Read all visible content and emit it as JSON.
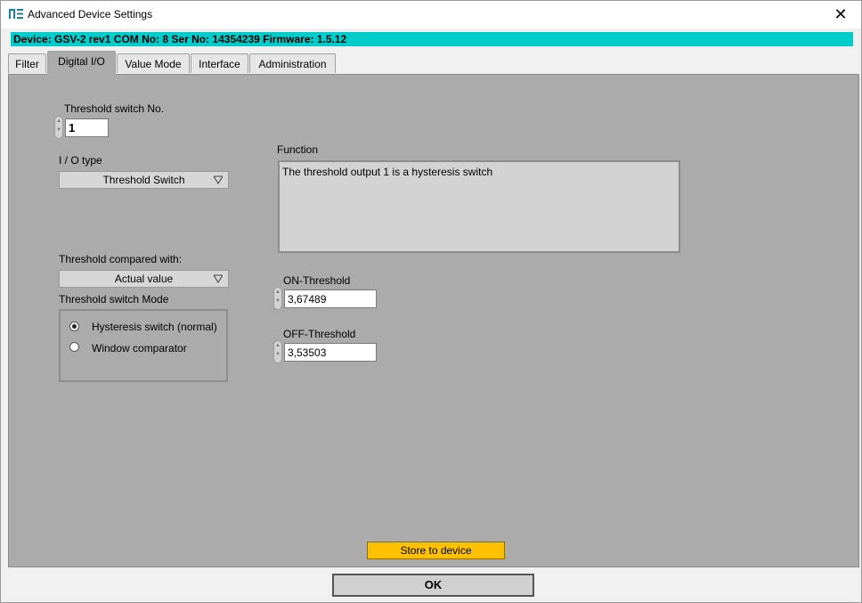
{
  "window": {
    "title": "Advanced Device Settings",
    "close_glyph": "✕"
  },
  "device_banner": "Device: GSV-2 rev1 COM No: 8 Ser No: 14354239 Firmware: 1.5.12",
  "tabs": [
    {
      "label": "Filter",
      "active": false
    },
    {
      "label": "Digital I/O",
      "active": true
    },
    {
      "label": "Value Mode",
      "active": false
    },
    {
      "label": "Interface",
      "active": false
    },
    {
      "label": "Administration",
      "active": false
    }
  ],
  "threshold_switch": {
    "label": "Threshold switch No.",
    "value": "1"
  },
  "io_type": {
    "label": "I / O type",
    "selected": "Threshold Switch"
  },
  "function": {
    "label": "Function",
    "text": "The threshold output 1 is a hysteresis switch"
  },
  "compared_with": {
    "label": "Threshold compared with:",
    "selected": "Actual value"
  },
  "switch_mode": {
    "label": "Threshold switch Mode",
    "options": [
      {
        "label": "Hysteresis switch (normal)",
        "checked": true
      },
      {
        "label": "Window comparator",
        "checked": false
      }
    ]
  },
  "on_threshold": {
    "label": "ON-Threshold",
    "value": "3,67489"
  },
  "off_threshold": {
    "label": "OFF-Threshold",
    "value": "3,53503"
  },
  "buttons": {
    "store": "Store to device",
    "ok": "OK"
  },
  "colors": {
    "banner": "#00cccc",
    "panel": "#ababab",
    "store_button": "#ffc000"
  }
}
